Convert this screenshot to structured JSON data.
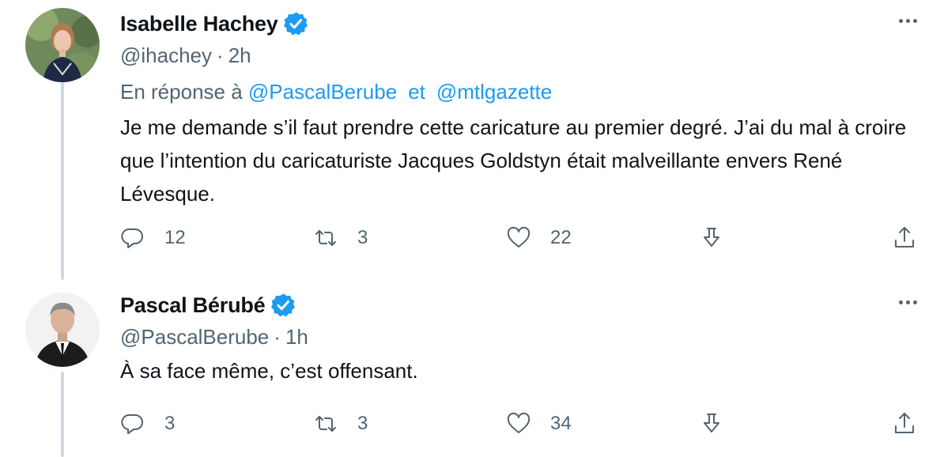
{
  "tweets": [
    {
      "display_name": "Isabelle Hachey",
      "handle": "@ihachey",
      "time_sep": "·",
      "time": "2h",
      "reply_prefix": "En réponse à",
      "reply_mention_1": "@PascalBerube",
      "reply_and": "et",
      "reply_mention_2": "@mtlgazette",
      "text": "Je me demande s’il faut prendre cette caricature au premier degré. J’ai du mal à croire que l’intention du caricaturiste Jacques Goldstyn était malveillante envers René Lévesque.",
      "replies": "12",
      "retweets": "3",
      "likes": "22"
    },
    {
      "display_name": "Pascal Bérubé",
      "handle": "@PascalBerube",
      "time_sep": "·",
      "time": "1h",
      "text": "À sa face même, c’est offensant.",
      "replies": "3",
      "retweets": "3",
      "likes": "34"
    }
  ],
  "icons": {
    "reply": "reply-icon",
    "retweet": "retweet-icon",
    "like": "heart-icon",
    "save": "bookmark-download-icon",
    "share": "share-icon",
    "verified": "verified-badge-icon",
    "more": "more-options-icon"
  },
  "colors": {
    "accent": "#1d9bf0",
    "secondary_text": "#536471",
    "primary_text": "#0f1419",
    "thread_line": "#cfd9de"
  }
}
